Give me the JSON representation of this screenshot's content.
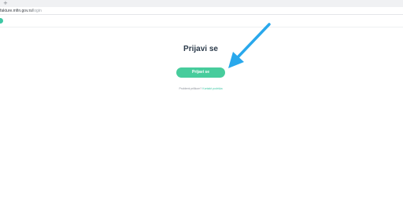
{
  "browser": {
    "new_tab_symbol": "+",
    "url_host": "fakture.mfin.gov.rs/",
    "url_path": "login"
  },
  "header": {
    "logo_icon": "circle-logo-icon",
    "logo_color": "#3ec7a4"
  },
  "login": {
    "title": "Prijavi se",
    "button_label": "Prijavi se",
    "forgot_prompt": "Problemi prilikom?",
    "forgot_link": "Kontakt podrška"
  },
  "colors": {
    "accent": "#47cc9c",
    "annotation_arrow": "#29a8ec"
  }
}
